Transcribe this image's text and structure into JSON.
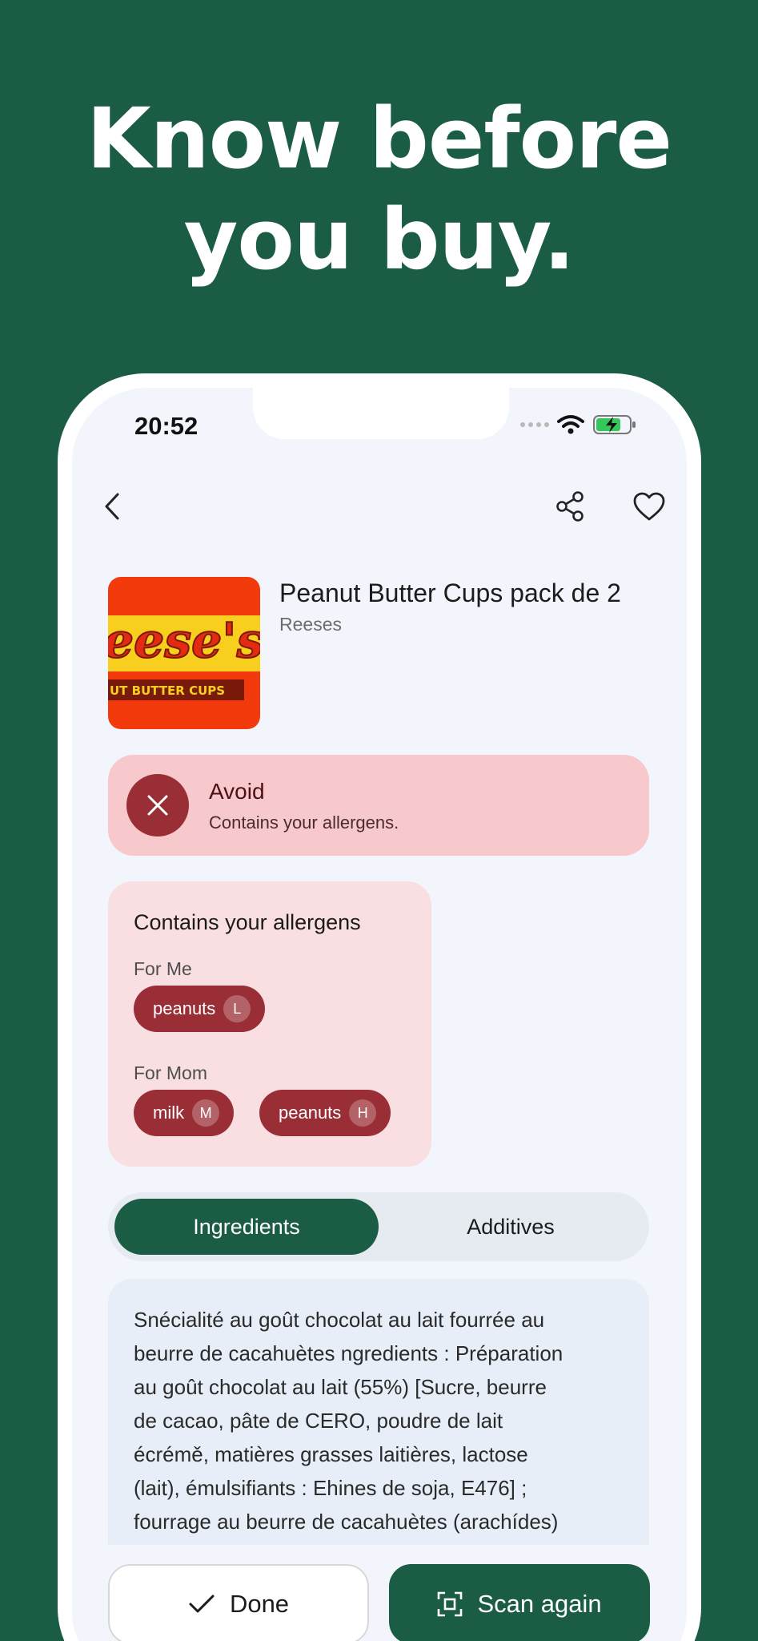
{
  "headline": {
    "line1": "Know before",
    "line2": "you buy."
  },
  "status_bar": {
    "time": "20:52",
    "icons": [
      "signal-dots-icon",
      "wifi-icon",
      "battery-charging-icon"
    ]
  },
  "nav": {
    "icons": [
      "back-icon",
      "share-icon",
      "heart-icon"
    ]
  },
  "product": {
    "name": "Peanut Butter Cups pack de 2",
    "brand": "Reeses",
    "image_text_main": "eese's",
    "image_text_sub": "UT BUTTER CUPS"
  },
  "verdict": {
    "title": "Avoid",
    "subtitle": "Contains your allergens.",
    "color": "#9a2e36"
  },
  "allergens": {
    "title": "Contains your allergens",
    "groups": [
      {
        "label": "For Me",
        "items": [
          {
            "name": "peanuts",
            "severity": "L"
          }
        ]
      },
      {
        "label": "For Mom",
        "items": [
          {
            "name": "milk",
            "severity": "M"
          },
          {
            "name": "peanuts",
            "severity": "H"
          }
        ]
      }
    ]
  },
  "tabs": [
    {
      "label": "Ingredients",
      "active": true
    },
    {
      "label": "Additives",
      "active": false
    }
  ],
  "ingredients": {
    "lines": [
      "Snécialité au goût chocolat au lait fourrée au",
      "beurre de cacahuètes ngredients : Préparation",
      "au goût chocolat au lait (55%) [Sucre, beurre",
      "de cacao, pâte de CERO, poudre de lait",
      "écrémě, matières grasses laitières, lactose",
      "(lait), émulsifiants : Ehines de soja, E476] ;",
      "fourrage au beurre de cacahuètes (arachídes)"
    ]
  },
  "actions": {
    "done": "Done",
    "scan": "Scan again"
  },
  "colors": {
    "brand_green": "#1b5c45",
    "avoid_red": "#9a2e36",
    "avoid_bg": "#f8c9cc"
  }
}
